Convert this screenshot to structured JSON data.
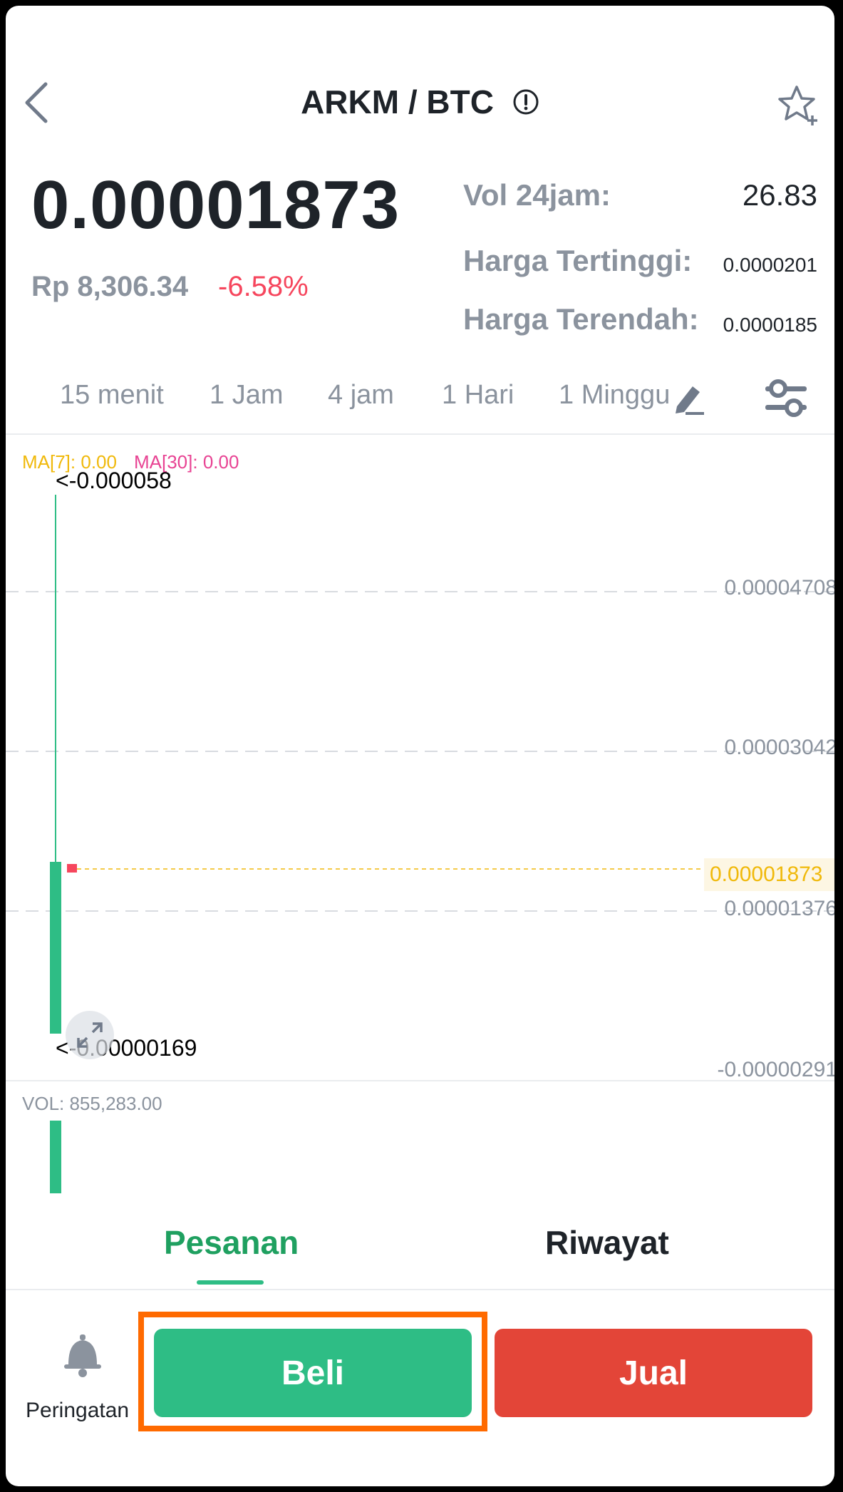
{
  "header": {
    "pair": "ARKM / BTC",
    "back_icon": "chevron-left-icon",
    "info_icon": "info-circle-icon",
    "favorite_icon": "star-plus-icon"
  },
  "price": {
    "last": "0.00001873",
    "fiat": "Rp 8,306.34",
    "change": "-6.58%"
  },
  "stats": {
    "vol_label": "Vol 24jam:",
    "vol_value": "26.83",
    "high_label": "Harga Tertinggi:",
    "high_value": "0.0000201",
    "low_label": "Harga Terendah:",
    "low_value": "0.0000185"
  },
  "timeframes": [
    "15 menit",
    "1 Jam",
    "4 jam",
    "1 Hari",
    "1 Minggu"
  ],
  "chart": {
    "ma7": "MA[7]: 0.00",
    "ma30": "MA[30]: 0.00",
    "high_marker": "<-0.000058",
    "low_marker": "<-0.00000169",
    "y_ticks": [
      "0.00004708",
      "0.00003042",
      "0.00001376",
      "-0.00000291"
    ],
    "current_price_tag": "0.00001873",
    "volume": "VOL: 855,283.00"
  },
  "chart_data": {
    "type": "candlestick",
    "title": "",
    "ylim": [
      -2.91e-06,
      5.8e-05
    ],
    "candles": [
      {
        "open": 2.6e-06,
        "close": 1.7e-05,
        "high": 5.8e-05,
        "low": 1.69e-06
      },
      {
        "open": 1.873e-05,
        "close": 1.873e-05,
        "high": 1.873e-05,
        "low": 1.873e-05
      }
    ],
    "current_price": 1.873e-05,
    "volume": [
      855283.0
    ]
  },
  "bottom_tabs": {
    "orders": "Pesanan",
    "history": "Riwayat"
  },
  "actions": {
    "alert_label": "Peringatan",
    "buy": "Beli",
    "sell": "Jual"
  },
  "colors": {
    "up": "#2ebd85",
    "down": "#f6465d",
    "sell_button": "#e34538",
    "highlight": "#ff6a00",
    "ma7": "#f0b90b",
    "ma30": "#e84393"
  }
}
